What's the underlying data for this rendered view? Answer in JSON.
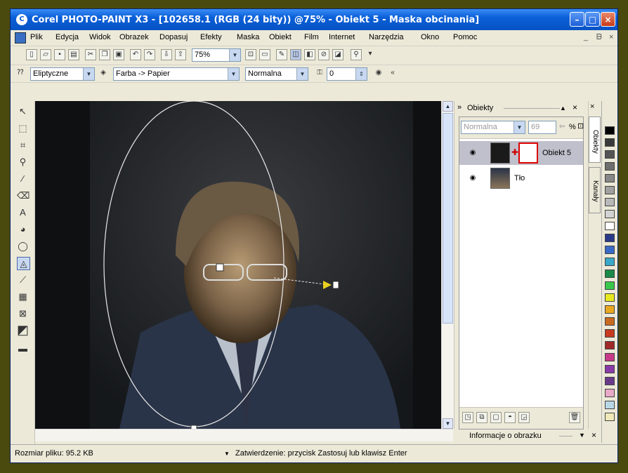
{
  "window": {
    "title": "Corel PHOTO-PAINT X3 - [102658.1 (RGB (24 bity)) @75% - Obiekt 5 - Maska obcinania]",
    "controls": {
      "minimize": "–",
      "maximize": "□",
      "close": "×"
    }
  },
  "menu": {
    "items": [
      "Plik",
      "Edycja",
      "Widok",
      "Obrazek",
      "Dopasuj",
      "Efekty",
      "Maska",
      "Obiekt",
      "Film",
      "Internet",
      "Narzędzia",
      "Okno",
      "Pomoc"
    ],
    "mdi_controls": [
      "_",
      "ᗷ",
      "×"
    ]
  },
  "toolbar1": {
    "zoom_value": "75%"
  },
  "toolbar2": {
    "shape_select": "Eliptyczne",
    "merge_mode": "Farba -> Papier",
    "blend_mode": "Normalna",
    "transparency_value": "0"
  },
  "dock": {
    "title": "Obiekty",
    "controls": {
      "collapse": "▲",
      "close": "×"
    },
    "obj_blend_mode": "Normalna",
    "obj_opacity": "69",
    "obj_percent": "%",
    "layers": [
      {
        "name": "Obiekt 5",
        "selected": true
      },
      {
        "name": "Tło",
        "selected": false
      }
    ],
    "side_tabs": [
      "Obiekty",
      "Kanały"
    ],
    "info_panel": "Informacje o obrazku"
  },
  "palette": {
    "colors": [
      "#000000",
      "#3a3a3a",
      "#555555",
      "#6e6e6e",
      "#878787",
      "#a0a0a0",
      "#b9b9b9",
      "#d2d2d2",
      "#ffffff",
      "#2a3a8a",
      "#3a6ac8",
      "#3aa8c8",
      "#1a8a4a",
      "#3ac84a",
      "#e8e820",
      "#e8a820",
      "#c86a20",
      "#c83a20",
      "#a02a2a",
      "#c83a8a",
      "#8a3aa8",
      "#6a3a8a",
      "#e8a8c8",
      "#b8d8e8",
      "#f0e8b8"
    ]
  },
  "status": {
    "file_size": "Rozmiar pliku: 95.2 KB",
    "hint": "Zatwierdzenie: przycisk Zastosuj lub klawisz Enter"
  }
}
